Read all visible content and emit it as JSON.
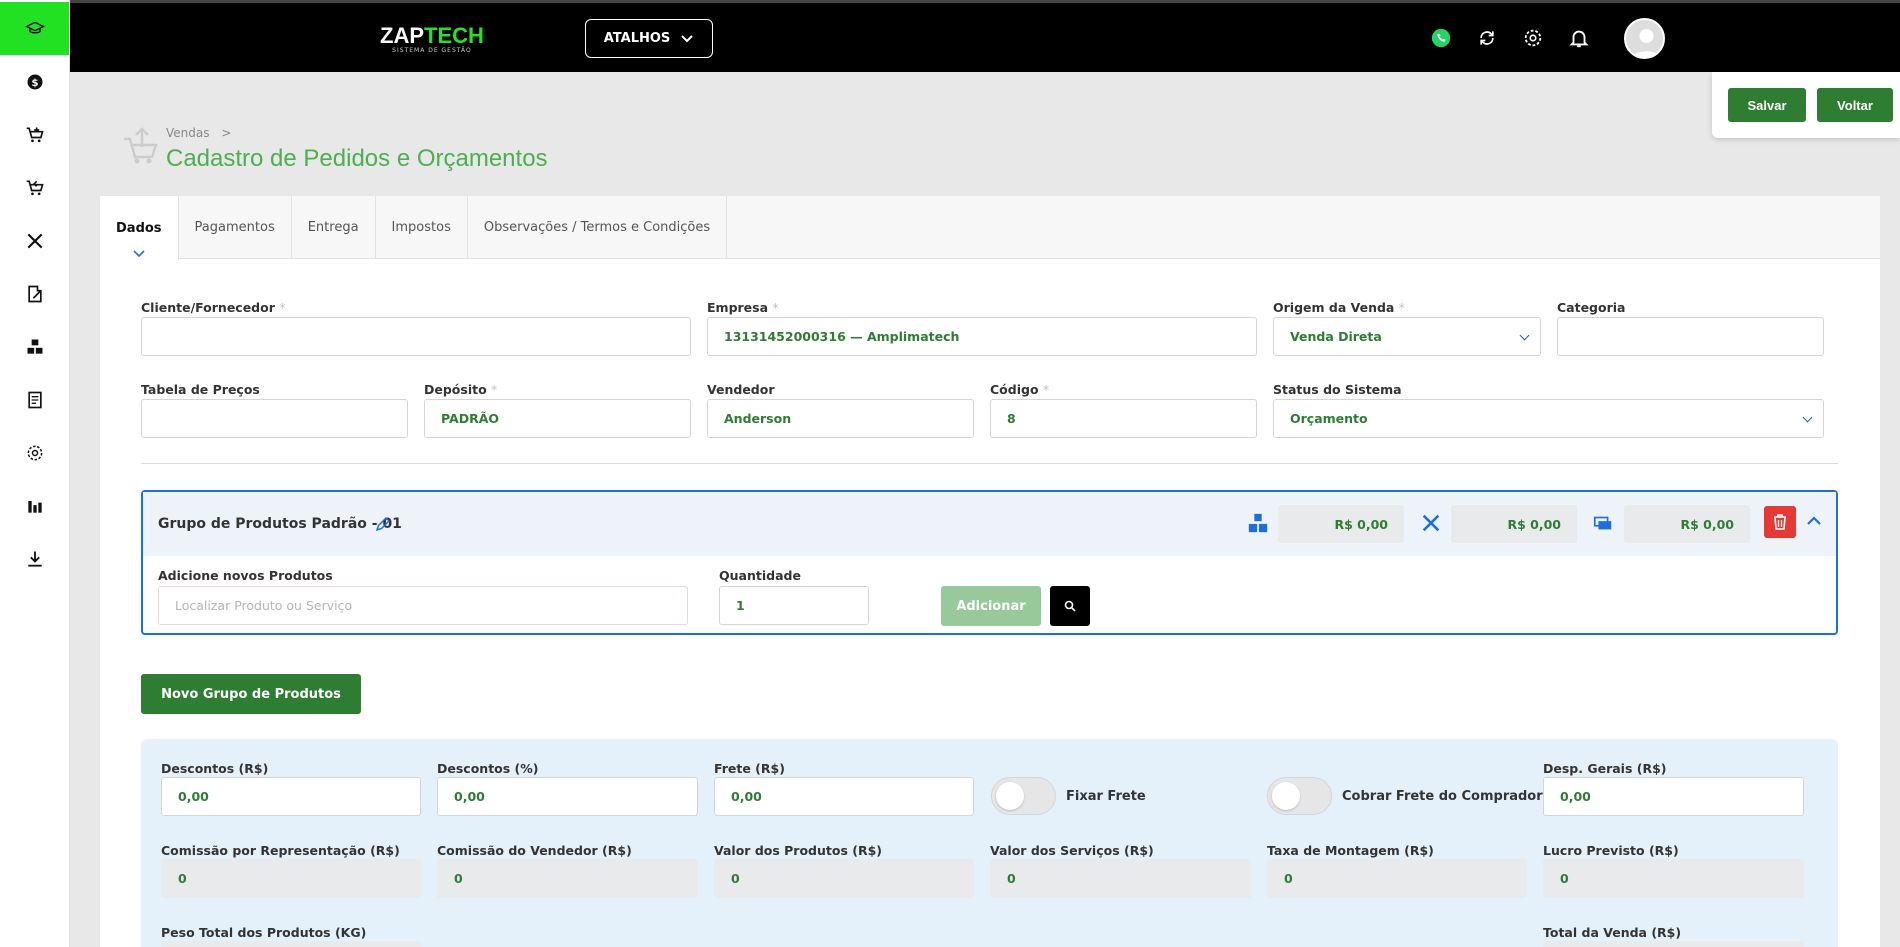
{
  "header": {
    "logo_main": "ZAP",
    "logo_accent": "TECH",
    "logo_sub": "SISTEMA DE GESTÃO",
    "shortcuts_label": "ATALHOS"
  },
  "actions": {
    "save": "Salvar",
    "back": "Voltar"
  },
  "breadcrumb": {
    "parent": "Vendas",
    "separator": ">"
  },
  "page_title": "Cadastro de Pedidos e Orçamentos",
  "tabs": [
    "Dados",
    "Pagamentos",
    "Entrega",
    "Impostos",
    "Observações / Termos e Condições"
  ],
  "form": {
    "cliente": {
      "label": "Cliente/Fornecedor",
      "value": ""
    },
    "empresa": {
      "label": "Empresa",
      "value": "13131452000316 — Amplimatech"
    },
    "origem": {
      "label": "Origem da Venda",
      "value": "Venda Direta"
    },
    "categoria": {
      "label": "Categoria",
      "value": ""
    },
    "tabela": {
      "label": "Tabela de Preços",
      "value": ""
    },
    "deposito": {
      "label": "Depósito",
      "value": "PADRÃO"
    },
    "vendedor": {
      "label": "Vendedor",
      "value": "Anderson"
    },
    "codigo": {
      "label": "Código",
      "value": "8"
    },
    "status": {
      "label": "Status do Sistema",
      "value": "Orçamento"
    },
    "required_mark": "*"
  },
  "group": {
    "title": "Grupo de Produtos Padrão - 01",
    "products_total": "R$ 0,00",
    "services_total": "R$ 0,00",
    "other_total": "R$ 0,00",
    "add_label": "Adicione novos Produtos",
    "add_placeholder": "Localizar Produto ou Serviço",
    "qty_label": "Quantidade",
    "qty_value": "1",
    "add_button": "Adicionar"
  },
  "new_group_button": "Novo Grupo de Produtos",
  "totals": {
    "descontos_rs": {
      "label": "Descontos (R$)",
      "value": "0,00"
    },
    "descontos_pct": {
      "label": "Descontos (%)",
      "value": "0,00"
    },
    "frete": {
      "label": "Frete (R$)",
      "value": "0,00"
    },
    "fixar_frete": "Fixar Frete",
    "cobrar_frete": "Cobrar Frete do Comprador",
    "desp_gerais": {
      "label": "Desp. Gerais (R$)",
      "value": "0,00"
    },
    "comissao_rep": {
      "label": "Comissão por Representação (R$)",
      "value": "0"
    },
    "comissao_vend": {
      "label": "Comissão do Vendedor (R$)",
      "value": "0"
    },
    "valor_produtos": {
      "label": "Valor dos Produtos (R$)",
      "value": "0"
    },
    "valor_servicos": {
      "label": "Valor dos Serviços (R$)",
      "value": "0"
    },
    "taxa_montagem": {
      "label": "Taxa de Montagem (R$)",
      "value": "0"
    },
    "lucro_previsto": {
      "label": "Lucro Previsto (R$)",
      "value": "0"
    },
    "peso_total": {
      "label": "Peso Total dos Produtos (KG)"
    },
    "total_venda": {
      "label": "Total da Venda (R$)"
    }
  },
  "colors": {
    "accent": "#2e7d32",
    "brand_green": "#22e022",
    "focus_blue": "#1e6fd9",
    "danger": "#e53935"
  }
}
